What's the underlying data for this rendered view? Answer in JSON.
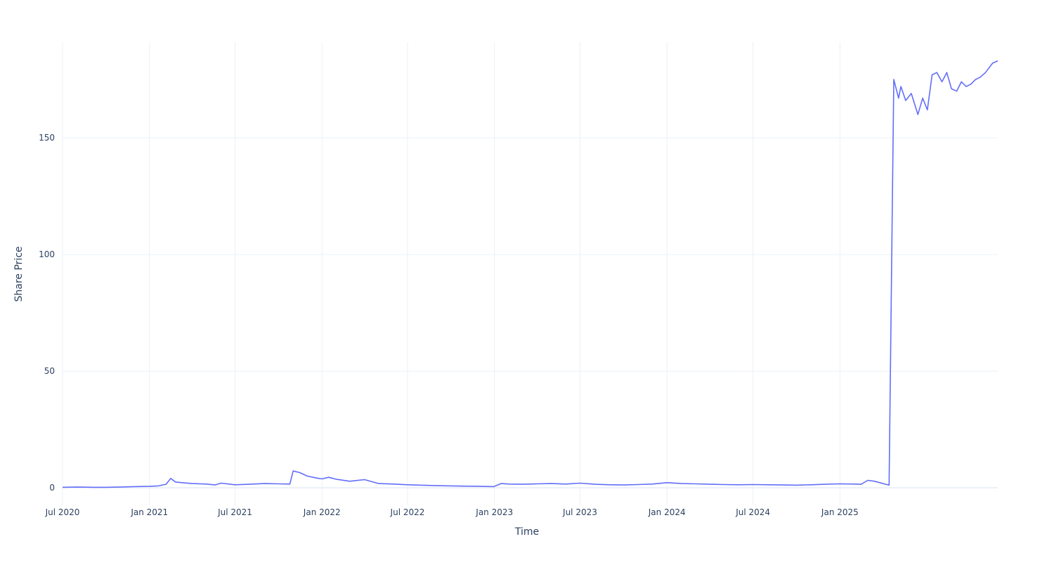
{
  "chart_data": {
    "type": "line",
    "title": "",
    "xlabel": "Time",
    "ylabel": "Share Price",
    "x_ticks": [
      "Jul 2020",
      "Jan 2021",
      "Jul 2021",
      "Jan 2022",
      "Jul 2022",
      "Jan 2023",
      "Jul 2023",
      "Jan 2024",
      "Jul 2024",
      "Jan 2025"
    ],
    "y_ticks": [
      "0",
      "50",
      "100",
      "150"
    ],
    "xlim": [
      "2020-07-01",
      "2025-12-01"
    ],
    "ylim": [
      -7.5,
      191
    ],
    "grid": true,
    "legend": false,
    "colors": {
      "line": "#636efa",
      "grid": "#ebf0f8",
      "zeroline": "#ebf0f8",
      "text": "#2a3f5f"
    },
    "series": [
      {
        "x": [
          "2020-07-01",
          "2020-08-01",
          "2020-09-01",
          "2020-10-01",
          "2020-11-01",
          "2020-12-01",
          "2021-01-01",
          "2021-01-20",
          "2021-02-05",
          "2021-02-15",
          "2021-02-25",
          "2021-03-10",
          "2021-04-01",
          "2021-05-01",
          "2021-05-20",
          "2021-06-01",
          "2021-07-01",
          "2021-08-01",
          "2021-09-01",
          "2021-10-01",
          "2021-10-25",
          "2021-11-01",
          "2021-11-15",
          "2021-12-01",
          "2021-12-20",
          "2022-01-01",
          "2022-01-15",
          "2022-02-01",
          "2022-03-01",
          "2022-04-01",
          "2022-05-01",
          "2022-06-01",
          "2022-07-01",
          "2022-08-01",
          "2022-09-01",
          "2022-10-01",
          "2022-11-01",
          "2022-12-01",
          "2022-12-31",
          "2023-01-15",
          "2023-02-01",
          "2023-03-01",
          "2023-04-01",
          "2023-05-01",
          "2023-06-01",
          "2023-07-01",
          "2023-08-01",
          "2023-09-01",
          "2023-10-01",
          "2023-11-01",
          "2023-12-01",
          "2024-01-01",
          "2024-02-01",
          "2024-03-01",
          "2024-04-01",
          "2024-05-01",
          "2024-06-01",
          "2024-07-01",
          "2024-08-01",
          "2024-09-01",
          "2024-10-01",
          "2024-11-01",
          "2024-12-01",
          "2025-01-01",
          "2025-02-01",
          "2025-02-15",
          "2025-03-01",
          "2025-03-15",
          "2025-04-15",
          "2025-04-25",
          "2025-05-05",
          "2025-05-10",
          "2025-05-20",
          "2025-06-01",
          "2025-06-15",
          "2025-06-25",
          "2025-07-05",
          "2025-07-15",
          "2025-07-25",
          "2025-08-05",
          "2025-08-15",
          "2025-08-25",
          "2025-09-05",
          "2025-09-15",
          "2025-09-25",
          "2025-10-05",
          "2025-10-15",
          "2025-10-25",
          "2025-11-05",
          "2025-11-20",
          "2025-12-01"
        ],
        "y": [
          0.2,
          0.3,
          0.2,
          0.2,
          0.3,
          0.5,
          0.6,
          0.8,
          1.5,
          4.0,
          2.5,
          2.2,
          1.8,
          1.6,
          1.2,
          2.0,
          1.3,
          1.5,
          1.8,
          1.7,
          1.6,
          7.2,
          6.5,
          5.0,
          4.2,
          3.8,
          4.5,
          3.6,
          2.8,
          3.5,
          1.8,
          1.6,
          1.3,
          1.1,
          0.9,
          0.8,
          0.7,
          0.6,
          0.5,
          1.8,
          1.6,
          1.5,
          1.7,
          1.8,
          1.6,
          2.0,
          1.5,
          1.3,
          1.2,
          1.4,
          1.6,
          2.2,
          1.8,
          1.7,
          1.5,
          1.4,
          1.3,
          1.4,
          1.3,
          1.2,
          1.1,
          1.3,
          1.5,
          1.7,
          1.6,
          1.5,
          3.2,
          2.8,
          1.1,
          175,
          167,
          172,
          166,
          169,
          160,
          167,
          162,
          177,
          178,
          174,
          178,
          171,
          170,
          174,
          172,
          173,
          175,
          176,
          178,
          182,
          183
        ]
      }
    ]
  }
}
